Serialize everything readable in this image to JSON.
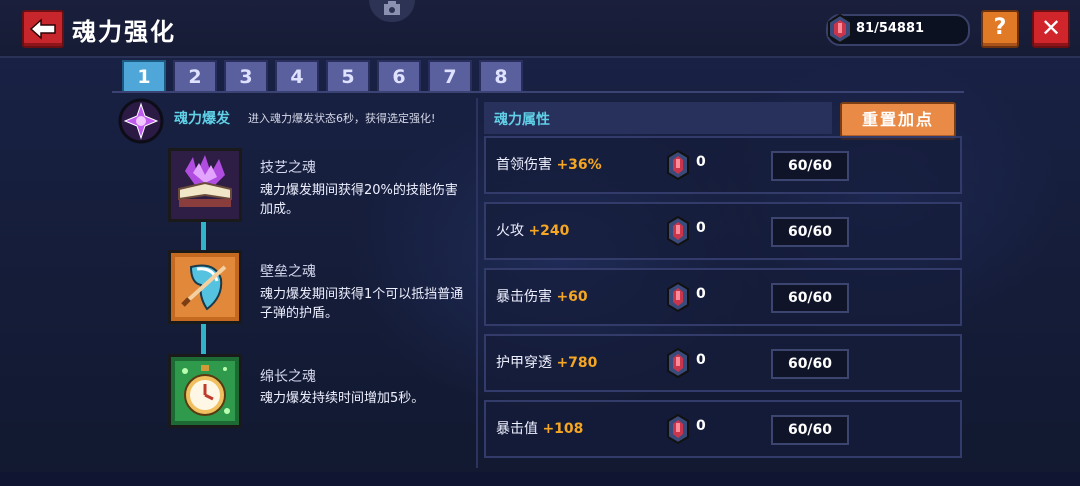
{
  "header": {
    "title": "魂力强化",
    "currency_value": "81/54881",
    "help_label": "?",
    "close_label": "✕"
  },
  "tabs": [
    {
      "label": "1",
      "active": true
    },
    {
      "label": "2"
    },
    {
      "label": "3"
    },
    {
      "label": "4"
    },
    {
      "label": "5"
    },
    {
      "label": "6"
    },
    {
      "label": "7"
    },
    {
      "label": "8"
    }
  ],
  "burst": {
    "title": "魂力爆发",
    "description": "进入魂力爆发状态6秒，获得选定强化!"
  },
  "skills": [
    {
      "name": "技艺之魂",
      "description": "魂力爆发期间获得20%的技能伤害加成。"
    },
    {
      "name": "壁垒之魂",
      "description": "魂力爆发期间获得1个可以抵挡普通子弹的护盾。"
    },
    {
      "name": "绵长之魂",
      "description": "魂力爆发持续时间增加5秒。"
    }
  ],
  "attributes_panel": {
    "header": "魂力属性",
    "reset_label": "重置加点",
    "rows": [
      {
        "name": "首领伤害",
        "bonus": "+36%",
        "count": "0",
        "level": "60/60"
      },
      {
        "name": "火攻",
        "bonus": "+240",
        "count": "0",
        "level": "60/60"
      },
      {
        "name": "暴击伤害",
        "bonus": "+60",
        "count": "0",
        "level": "60/60"
      },
      {
        "name": "护甲穿透",
        "bonus": "+780",
        "count": "0",
        "level": "60/60"
      },
      {
        "name": "暴击值",
        "bonus": "+108",
        "count": "0",
        "level": "60/60"
      }
    ]
  },
  "colors": {
    "accent_cyan": "#5fd0e6",
    "bonus_orange": "#f5a623",
    "tab_active": "#4ea7d8",
    "tab_inactive": "#5a5f9e",
    "reset_button": "#e98a46",
    "close_button": "#d1252c"
  }
}
